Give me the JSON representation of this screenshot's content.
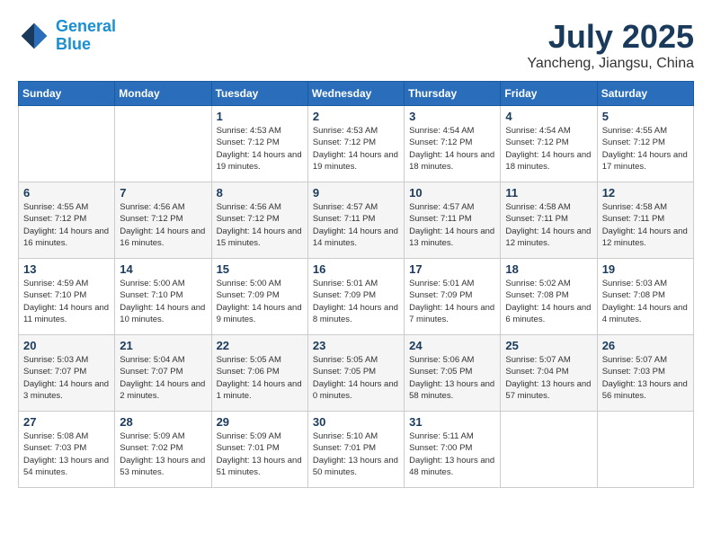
{
  "header": {
    "logo_line1": "General",
    "logo_line2": "Blue",
    "month": "July 2025",
    "location": "Yancheng, Jiangsu, China"
  },
  "weekdays": [
    "Sunday",
    "Monday",
    "Tuesday",
    "Wednesday",
    "Thursday",
    "Friday",
    "Saturday"
  ],
  "weeks": [
    [
      {
        "day": "",
        "sunrise": "",
        "sunset": "",
        "daylight": ""
      },
      {
        "day": "",
        "sunrise": "",
        "sunset": "",
        "daylight": ""
      },
      {
        "day": "1",
        "sunrise": "Sunrise: 4:53 AM",
        "sunset": "Sunset: 7:12 PM",
        "daylight": "Daylight: 14 hours and 19 minutes."
      },
      {
        "day": "2",
        "sunrise": "Sunrise: 4:53 AM",
        "sunset": "Sunset: 7:12 PM",
        "daylight": "Daylight: 14 hours and 19 minutes."
      },
      {
        "day": "3",
        "sunrise": "Sunrise: 4:54 AM",
        "sunset": "Sunset: 7:12 PM",
        "daylight": "Daylight: 14 hours and 18 minutes."
      },
      {
        "day": "4",
        "sunrise": "Sunrise: 4:54 AM",
        "sunset": "Sunset: 7:12 PM",
        "daylight": "Daylight: 14 hours and 18 minutes."
      },
      {
        "day": "5",
        "sunrise": "Sunrise: 4:55 AM",
        "sunset": "Sunset: 7:12 PM",
        "daylight": "Daylight: 14 hours and 17 minutes."
      }
    ],
    [
      {
        "day": "6",
        "sunrise": "Sunrise: 4:55 AM",
        "sunset": "Sunset: 7:12 PM",
        "daylight": "Daylight: 14 hours and 16 minutes."
      },
      {
        "day": "7",
        "sunrise": "Sunrise: 4:56 AM",
        "sunset": "Sunset: 7:12 PM",
        "daylight": "Daylight: 14 hours and 16 minutes."
      },
      {
        "day": "8",
        "sunrise": "Sunrise: 4:56 AM",
        "sunset": "Sunset: 7:12 PM",
        "daylight": "Daylight: 14 hours and 15 minutes."
      },
      {
        "day": "9",
        "sunrise": "Sunrise: 4:57 AM",
        "sunset": "Sunset: 7:11 PM",
        "daylight": "Daylight: 14 hours and 14 minutes."
      },
      {
        "day": "10",
        "sunrise": "Sunrise: 4:57 AM",
        "sunset": "Sunset: 7:11 PM",
        "daylight": "Daylight: 14 hours and 13 minutes."
      },
      {
        "day": "11",
        "sunrise": "Sunrise: 4:58 AM",
        "sunset": "Sunset: 7:11 PM",
        "daylight": "Daylight: 14 hours and 12 minutes."
      },
      {
        "day": "12",
        "sunrise": "Sunrise: 4:58 AM",
        "sunset": "Sunset: 7:11 PM",
        "daylight": "Daylight: 14 hours and 12 minutes."
      }
    ],
    [
      {
        "day": "13",
        "sunrise": "Sunrise: 4:59 AM",
        "sunset": "Sunset: 7:10 PM",
        "daylight": "Daylight: 14 hours and 11 minutes."
      },
      {
        "day": "14",
        "sunrise": "Sunrise: 5:00 AM",
        "sunset": "Sunset: 7:10 PM",
        "daylight": "Daylight: 14 hours and 10 minutes."
      },
      {
        "day": "15",
        "sunrise": "Sunrise: 5:00 AM",
        "sunset": "Sunset: 7:09 PM",
        "daylight": "Daylight: 14 hours and 9 minutes."
      },
      {
        "day": "16",
        "sunrise": "Sunrise: 5:01 AM",
        "sunset": "Sunset: 7:09 PM",
        "daylight": "Daylight: 14 hours and 8 minutes."
      },
      {
        "day": "17",
        "sunrise": "Sunrise: 5:01 AM",
        "sunset": "Sunset: 7:09 PM",
        "daylight": "Daylight: 14 hours and 7 minutes."
      },
      {
        "day": "18",
        "sunrise": "Sunrise: 5:02 AM",
        "sunset": "Sunset: 7:08 PM",
        "daylight": "Daylight: 14 hours and 6 minutes."
      },
      {
        "day": "19",
        "sunrise": "Sunrise: 5:03 AM",
        "sunset": "Sunset: 7:08 PM",
        "daylight": "Daylight: 14 hours and 4 minutes."
      }
    ],
    [
      {
        "day": "20",
        "sunrise": "Sunrise: 5:03 AM",
        "sunset": "Sunset: 7:07 PM",
        "daylight": "Daylight: 14 hours and 3 minutes."
      },
      {
        "day": "21",
        "sunrise": "Sunrise: 5:04 AM",
        "sunset": "Sunset: 7:07 PM",
        "daylight": "Daylight: 14 hours and 2 minutes."
      },
      {
        "day": "22",
        "sunrise": "Sunrise: 5:05 AM",
        "sunset": "Sunset: 7:06 PM",
        "daylight": "Daylight: 14 hours and 1 minute."
      },
      {
        "day": "23",
        "sunrise": "Sunrise: 5:05 AM",
        "sunset": "Sunset: 7:05 PM",
        "daylight": "Daylight: 14 hours and 0 minutes."
      },
      {
        "day": "24",
        "sunrise": "Sunrise: 5:06 AM",
        "sunset": "Sunset: 7:05 PM",
        "daylight": "Daylight: 13 hours and 58 minutes."
      },
      {
        "day": "25",
        "sunrise": "Sunrise: 5:07 AM",
        "sunset": "Sunset: 7:04 PM",
        "daylight": "Daylight: 13 hours and 57 minutes."
      },
      {
        "day": "26",
        "sunrise": "Sunrise: 5:07 AM",
        "sunset": "Sunset: 7:03 PM",
        "daylight": "Daylight: 13 hours and 56 minutes."
      }
    ],
    [
      {
        "day": "27",
        "sunrise": "Sunrise: 5:08 AM",
        "sunset": "Sunset: 7:03 PM",
        "daylight": "Daylight: 13 hours and 54 minutes."
      },
      {
        "day": "28",
        "sunrise": "Sunrise: 5:09 AM",
        "sunset": "Sunset: 7:02 PM",
        "daylight": "Daylight: 13 hours and 53 minutes."
      },
      {
        "day": "29",
        "sunrise": "Sunrise: 5:09 AM",
        "sunset": "Sunset: 7:01 PM",
        "daylight": "Daylight: 13 hours and 51 minutes."
      },
      {
        "day": "30",
        "sunrise": "Sunrise: 5:10 AM",
        "sunset": "Sunset: 7:01 PM",
        "daylight": "Daylight: 13 hours and 50 minutes."
      },
      {
        "day": "31",
        "sunrise": "Sunrise: 5:11 AM",
        "sunset": "Sunset: 7:00 PM",
        "daylight": "Daylight: 13 hours and 48 minutes."
      },
      {
        "day": "",
        "sunrise": "",
        "sunset": "",
        "daylight": ""
      },
      {
        "day": "",
        "sunrise": "",
        "sunset": "",
        "daylight": ""
      }
    ]
  ]
}
